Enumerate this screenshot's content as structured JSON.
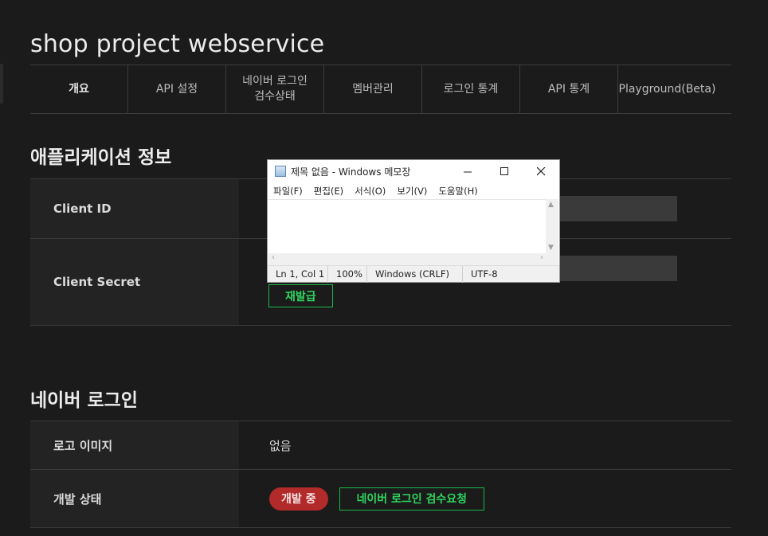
{
  "app_title": "shop project webservice",
  "tabs": [
    {
      "label": "개요",
      "active": true
    },
    {
      "label": "API 설정"
    },
    {
      "label": "네이버 로그인\n검수상태"
    },
    {
      "label": "멤버관리"
    },
    {
      "label": "로그인 통계"
    },
    {
      "label": "API 통계"
    },
    {
      "label": "Playground(Beta)"
    }
  ],
  "app_info": {
    "title": "애플리케이션 정보",
    "client_id_label": "Client ID",
    "client_secret_label": "Client Secret",
    "reissue_button": "재발급"
  },
  "naver_login": {
    "title": "네이버 로그인",
    "logo_label": "로고 이미지",
    "logo_value": "없음",
    "status_label": "개발 상태",
    "status_badge": "개발 중",
    "review_button": "네이버 로그인 검수요청"
  },
  "notepad": {
    "title": "제목 없음 - Windows 메모장",
    "menus": [
      "파일(F)",
      "편집(E)",
      "서식(O)",
      "보기(V)",
      "도움말(H)"
    ],
    "status": {
      "position": "Ln 1, Col 1",
      "zoom": "100%",
      "line_ending": "Windows (CRLF)",
      "encoding": "UTF-8"
    }
  },
  "colors": {
    "background": "#1b1b1b",
    "accent_green": "#19b74a",
    "badge_red": "#b32a2a"
  }
}
